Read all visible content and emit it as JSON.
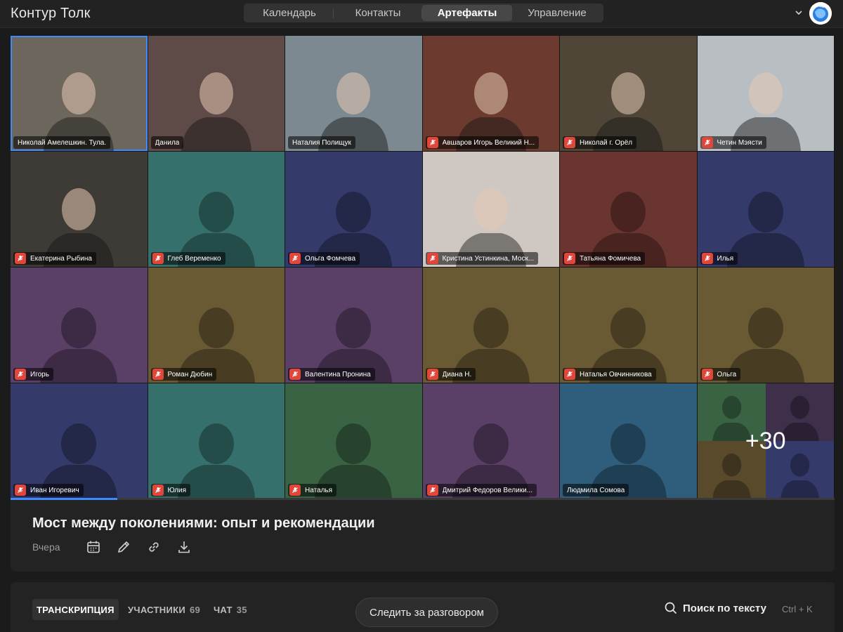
{
  "app": {
    "title": "Контур Толк"
  },
  "nav": {
    "tabs": [
      {
        "label": "Календарь",
        "active": false
      },
      {
        "label": "Контакты",
        "active": false
      },
      {
        "label": "Артефакты",
        "active": true
      },
      {
        "label": "Управление",
        "active": false
      }
    ]
  },
  "colors": {
    "accent": "#3d8bff",
    "mic_off": "#e0463a",
    "tile_teal": "#36706c",
    "tile_navy": "#343a6a",
    "tile_purple": "#5a3f66",
    "tile_olive": "#6a5a34",
    "tile_red": "#6a3430",
    "tile_green": "#3a6344",
    "tile_blue": "#2f5e7c"
  },
  "participants": [
    {
      "name": "Николай Амелешкин. Тула.",
      "muted": false,
      "video": true,
      "speaking": true,
      "bg": "#6d665c"
    },
    {
      "name": "Данила",
      "muted": false,
      "video": true,
      "bg": "#5e4a46"
    },
    {
      "name": "Наталия Полищук",
      "muted": false,
      "video": true,
      "bg": "#7c8990"
    },
    {
      "name": "Авшаров Игорь Великий Н...",
      "muted": true,
      "video": true,
      "bg": "#6c3a2e"
    },
    {
      "name": "Николай г. Орёл",
      "muted": true,
      "video": true,
      "bg": "#4f4638"
    },
    {
      "name": "Четин Мэясти",
      "muted": true,
      "video": true,
      "bg": "#b8bec2"
    },
    {
      "name": "Екатерина Рыбина",
      "muted": true,
      "video": true,
      "bg": "#3e3a36"
    },
    {
      "name": "Глеб Веременко",
      "muted": true,
      "video": false,
      "bg": "#36706c"
    },
    {
      "name": "Ольга Фомчева",
      "muted": true,
      "video": false,
      "bg": "#343a6a"
    },
    {
      "name": "Кристина Устинкина, Моск...",
      "muted": true,
      "video": true,
      "bg": "#cfc8c2"
    },
    {
      "name": "Татьяна Фомичева",
      "muted": true,
      "video": false,
      "bg": "#6a3430"
    },
    {
      "name": "Илья",
      "muted": true,
      "video": false,
      "bg": "#343a6a"
    },
    {
      "name": "Игорь",
      "muted": true,
      "video": false,
      "bg": "#5a3f66"
    },
    {
      "name": "Роман Дюбин",
      "muted": true,
      "video": false,
      "bg": "#6a5a34"
    },
    {
      "name": "Валентина Пронина",
      "muted": true,
      "video": false,
      "bg": "#5a3f66"
    },
    {
      "name": "Диана Н.",
      "muted": true,
      "video": false,
      "bg": "#6a5a34"
    },
    {
      "name": "Наталья Овчинникова",
      "muted": true,
      "video": false,
      "bg": "#6a5a34"
    },
    {
      "name": "Ольга",
      "muted": true,
      "video": false,
      "bg": "#6a5a34"
    },
    {
      "name": "Иван Игоревич",
      "muted": true,
      "video": false,
      "bg": "#343a6a"
    },
    {
      "name": "Юлия",
      "muted": true,
      "video": false,
      "bg": "#36706c"
    },
    {
      "name": "Наталья",
      "muted": true,
      "video": false,
      "bg": "#3a6344"
    },
    {
      "name": "Дмитрий Федоров Велики...",
      "muted": true,
      "video": false,
      "bg": "#5a3f66"
    },
    {
      "name": "Людмила Сомова",
      "muted": false,
      "video": false,
      "bg": "#2f5e7c"
    }
  ],
  "more": {
    "label": "+30",
    "quad_colors": [
      "#3a6344",
      "#3e2f4a",
      "#5a4a2c",
      "#343a6a"
    ]
  },
  "playback": {
    "progress": 0.13
  },
  "meeting": {
    "title": "Мост между поколениями: опыт и рекомендации",
    "date": "Вчера",
    "actions": [
      "calendar-icon",
      "edit-icon",
      "link-icon",
      "download-icon"
    ]
  },
  "panel": {
    "tabs": [
      {
        "label": "ТРАНСКРИПЦИЯ",
        "count": "",
        "active": true
      },
      {
        "label": "УЧАСТНИКИ",
        "count": "69",
        "active": false
      },
      {
        "label": "ЧАТ",
        "count": "35",
        "active": false
      }
    ],
    "follow_label": "Следить за разговором",
    "search_label": "Поиск по тексту",
    "shortcut": "Ctrl + K"
  }
}
